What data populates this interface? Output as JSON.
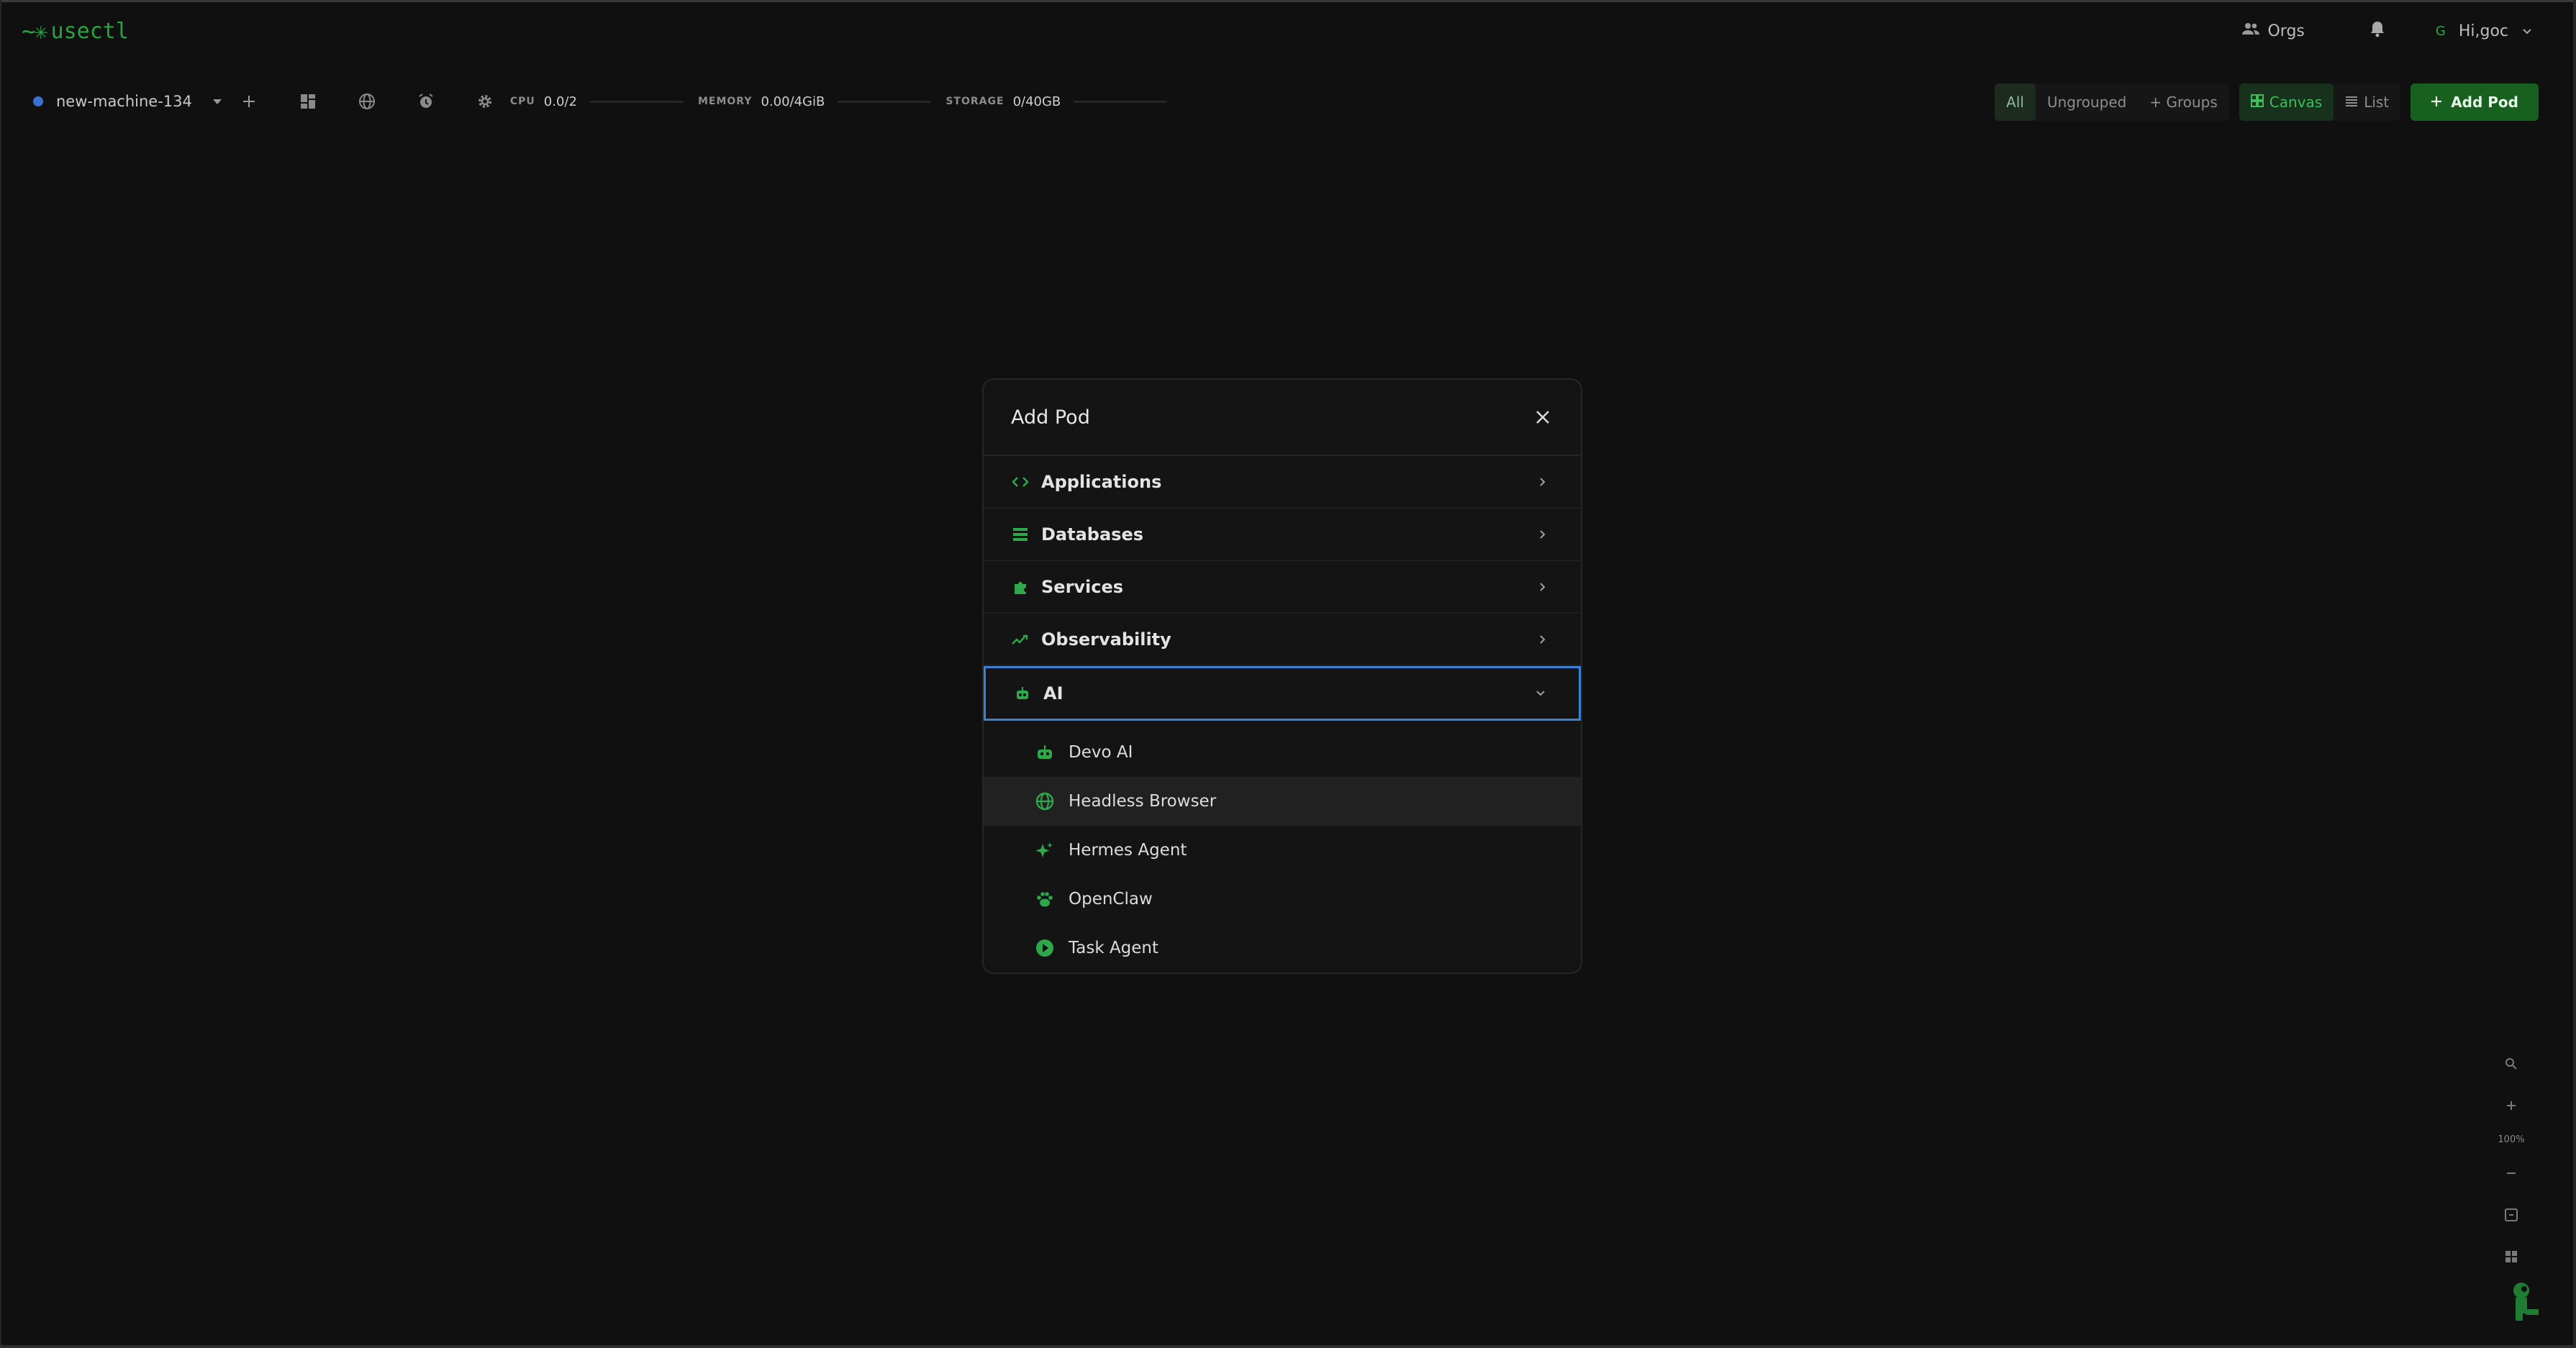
{
  "app": {
    "logo_mark": "~✳",
    "logo_text": "usectl"
  },
  "header": {
    "orgs_label": "Orgs",
    "user_initial": "G",
    "user_label": "Hi,goc"
  },
  "machine": {
    "name": "new-machine-134"
  },
  "resources": {
    "cpu": {
      "label": "CPU",
      "value": "0.0/2"
    },
    "memory": {
      "label": "MEMORY",
      "value": "0.00/4GiB"
    },
    "storage": {
      "label": "STORAGE",
      "value": "0/40GB"
    }
  },
  "filters": {
    "all": "All",
    "ungrouped": "Ungrouped",
    "groups": "+ Groups"
  },
  "views": {
    "canvas": "Canvas",
    "list": "List"
  },
  "add_pod_button": "Add Pod",
  "modal": {
    "title": "Add Pod",
    "categories": [
      {
        "label": "Applications",
        "icon": "code-icon"
      },
      {
        "label": "Databases",
        "icon": "database-icon"
      },
      {
        "label": "Services",
        "icon": "puzzle-icon"
      },
      {
        "label": "Observability",
        "icon": "trending-icon"
      },
      {
        "label": "AI",
        "icon": "robot-icon",
        "expanded": true
      }
    ],
    "ai_items": [
      {
        "label": "Devo AI",
        "icon": "robot-icon"
      },
      {
        "label": "Headless Browser",
        "icon": "globe-icon"
      },
      {
        "label": "Hermes Agent",
        "icon": "sparkle-icon"
      },
      {
        "label": "OpenClaw",
        "icon": "paw-icon"
      },
      {
        "label": "Task Agent",
        "icon": "play-circle-icon"
      }
    ]
  },
  "zoom": {
    "level": "100%"
  },
  "colors": {
    "accent": "#27a33f",
    "focus": "#3b7fd6",
    "background": "#101010"
  }
}
